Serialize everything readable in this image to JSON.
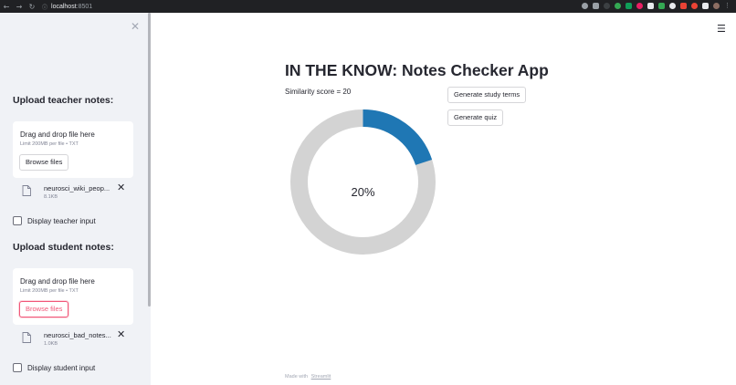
{
  "browser": {
    "url_host": "localhost",
    "url_port": ":8501",
    "back_icon": "arrow-left-icon",
    "forward_icon": "arrow-right-icon",
    "reload_icon": "reload-icon"
  },
  "sidebar": {
    "close_icon": "close-icon",
    "teacher": {
      "heading": "Upload teacher notes:",
      "dropzone_title": "Drag and drop file here",
      "dropzone_limit": "Limit 200MB per file • TXT",
      "browse_label": "Browse files",
      "file_name": "neurosci_wiki_peop...",
      "file_size": "8.1KB",
      "checkbox_label": "Display teacher input"
    },
    "student": {
      "heading": "Upload student notes:",
      "dropzone_title": "Drag and drop file here",
      "dropzone_limit": "Limit 200MB per file • TXT",
      "browse_label": "Browse files",
      "file_name": "neurosci_bad_notes...",
      "file_size": "1.0KB",
      "checkbox_label": "Display student input"
    }
  },
  "main": {
    "menu_icon": "hamburger-menu-icon",
    "title": "IN THE KNOW: Notes Checker App",
    "similarity_text": "Similarity score = 20",
    "buttons": {
      "study_terms": "Generate study terms",
      "quiz": "Generate quiz"
    },
    "donut": {
      "value_percent": 20,
      "label": "20%",
      "fill_color": "#1f77b4",
      "track_color": "#d3d3d3"
    },
    "footer": {
      "made_with": "Made with",
      "link": "Streamlit"
    }
  },
  "colors": {
    "sidebar_bg": "#f0f2f6",
    "accent": "#f15779",
    "chrome_bg": "#202124"
  }
}
